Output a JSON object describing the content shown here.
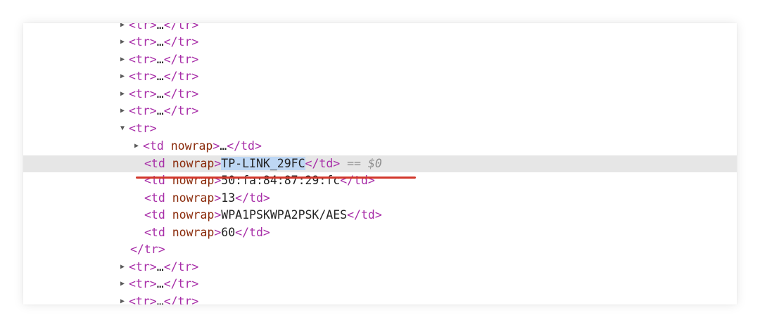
{
  "dom_tree": {
    "collapsed_rows_top": [
      {
        "open": "<tr>",
        "ellipsis": "…",
        "close": "</tr>"
      },
      {
        "open": "<tr>",
        "ellipsis": "…",
        "close": "</tr>"
      },
      {
        "open": "<tr>",
        "ellipsis": "…",
        "close": "</tr>"
      },
      {
        "open": "<tr>",
        "ellipsis": "…",
        "close": "</tr>"
      },
      {
        "open": "<tr>",
        "ellipsis": "…",
        "close": "</tr>"
      },
      {
        "open": "<tr>",
        "ellipsis": "…",
        "close": "</tr>"
      }
    ],
    "expanded_row": {
      "open": "<tr>",
      "close": "</tr>",
      "collapsed_cell": {
        "open": "<td",
        "attr": "nowrap",
        "gt": ">",
        "ellipsis": "…",
        "close": "</td>"
      },
      "cells": [
        {
          "open": "<td",
          "attr": "nowrap",
          "gt": ">",
          "text": "TP-LINK_29FC",
          "close": "</td>",
          "selected": true,
          "eq": "==",
          "ref": "$0"
        },
        {
          "open": "<td",
          "attr": "nowrap",
          "gt": ">",
          "text": "50:fa:84:87:29:fc",
          "close": "</td>"
        },
        {
          "open": "<td",
          "attr": "nowrap",
          "gt": ">",
          "text": "13",
          "close": "</td>"
        },
        {
          "open": "<td",
          "attr": "nowrap",
          "gt": ">",
          "text": "WPA1PSKWPA2PSK/AES",
          "close": "</td>"
        },
        {
          "open": "<td",
          "attr": "nowrap",
          "gt": ">",
          "text": "60",
          "close": "</td>"
        }
      ]
    },
    "collapsed_rows_bottom": [
      {
        "open": "<tr>",
        "ellipsis": "…",
        "close": "</tr>"
      },
      {
        "open": "<tr>",
        "ellipsis": "…",
        "close": "</tr>"
      },
      {
        "open": "<tr>",
        "ellipsis": "…",
        "close": "</tr>"
      }
    ]
  },
  "icons": {
    "expand": "triangle-right-icon",
    "collapse": "triangle-down-icon"
  },
  "colors": {
    "tag": "#a82ea8",
    "attribute": "#8a2a0a",
    "text": "#222222",
    "selected_line_bg": "#e6e6e6",
    "selected_text_bg": "#bed7f4",
    "annotation_underline": "#d2382c"
  }
}
